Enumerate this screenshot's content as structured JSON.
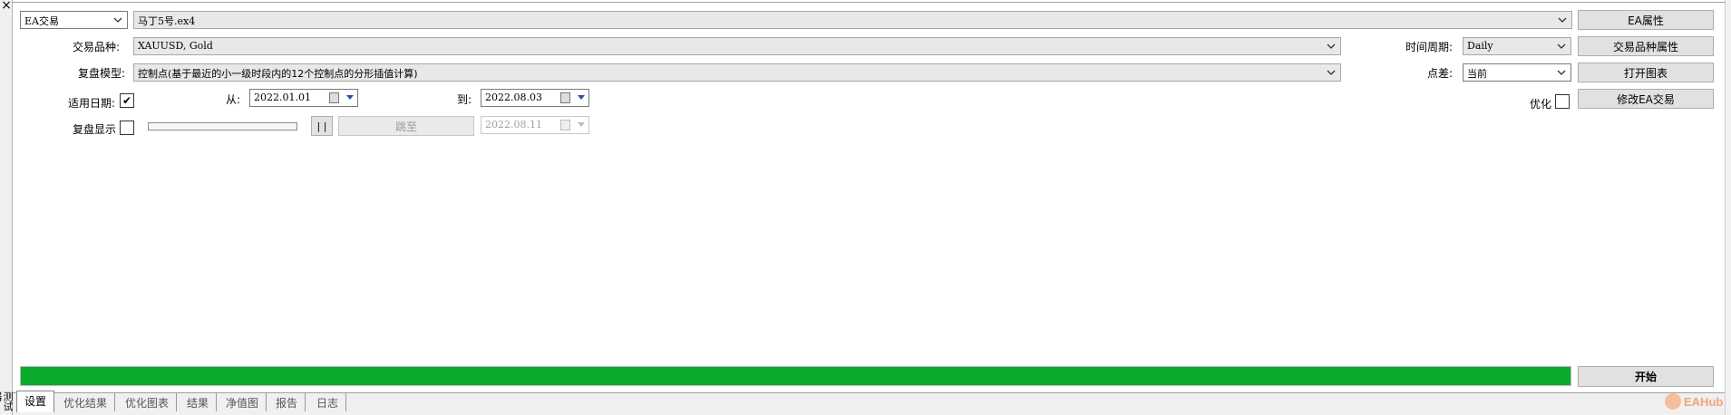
{
  "side_panel": {
    "close_glyph": "×",
    "vertical_label": "测试器"
  },
  "ea_row": {
    "type_select": "EA交易",
    "ea_file": "马丁5号.ex4",
    "properties_button": "EA属性"
  },
  "symbol_row": {
    "label": "交易品种:",
    "value": "XAUUSD, Gold",
    "period_label": "时间周期:",
    "period_value": "Daily",
    "symbol_properties_button": "交易品种属性"
  },
  "model_row": {
    "label": "复盘模型:",
    "value": "控制点(基于最近的小一级时段内的12个控制点的分形插值计算)",
    "spread_label": "点差:",
    "spread_value": "当前",
    "open_chart_button": "打开图表"
  },
  "date_row": {
    "label": "适用日期:",
    "checked": true,
    "check_glyph": "✔",
    "from_label": "从:",
    "from_date": "2022.01.01",
    "to_label": "到:",
    "to_date": "2022.08.03",
    "optimization_label": "优化",
    "optimization_checked": false,
    "modify_button": "修改EA交易"
  },
  "visual_row": {
    "label": "复盘显示",
    "checked": false,
    "pause_button": "| |",
    "skip_button": "跳至",
    "skip_date": "2022.08.11",
    "speed_level": 0
  },
  "progress": {
    "fraction": 1.0,
    "color": "#0aaa2a"
  },
  "start_button": "开始",
  "tabs": [
    {
      "label": "设置",
      "active": true
    },
    {
      "label": "优化结果",
      "active": false
    },
    {
      "label": "优化图表",
      "active": false
    },
    {
      "label": "结果",
      "active": false
    },
    {
      "label": "净值图",
      "active": false
    },
    {
      "label": "报告",
      "active": false
    },
    {
      "label": "日志",
      "active": false
    }
  ],
  "watermark": "EAHub"
}
